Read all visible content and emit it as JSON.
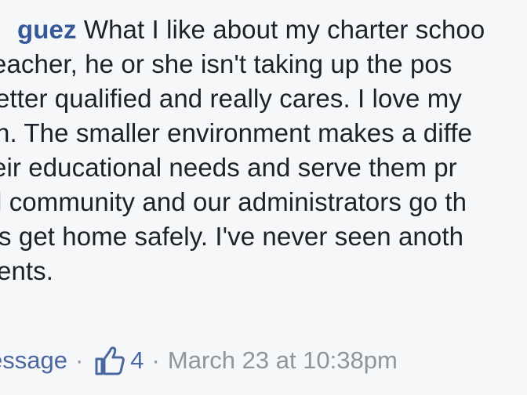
{
  "comment": {
    "author_fragment": "guez",
    "lines": [
      "What I like about my charter schoo",
      "eacher, he or she isn't taking up the pos",
      "etter qualified and really cares. I love my",
      "n. The smaller environment makes a diffe",
      "eir educational needs and serve them pr",
      "l community and our administrators go th",
      "s get home safely. I've never seen anoth",
      "ents."
    ],
    "actions": {
      "message_link": "essage",
      "separator": "·",
      "like_count": "4",
      "timestamp": "March 23 at 10:38pm"
    },
    "icons": {
      "like": "thumbs-up-icon"
    },
    "colors": {
      "link": "#365899",
      "meta": "#90949c",
      "text": "#1d2129",
      "background": "#f6f7f9"
    }
  }
}
